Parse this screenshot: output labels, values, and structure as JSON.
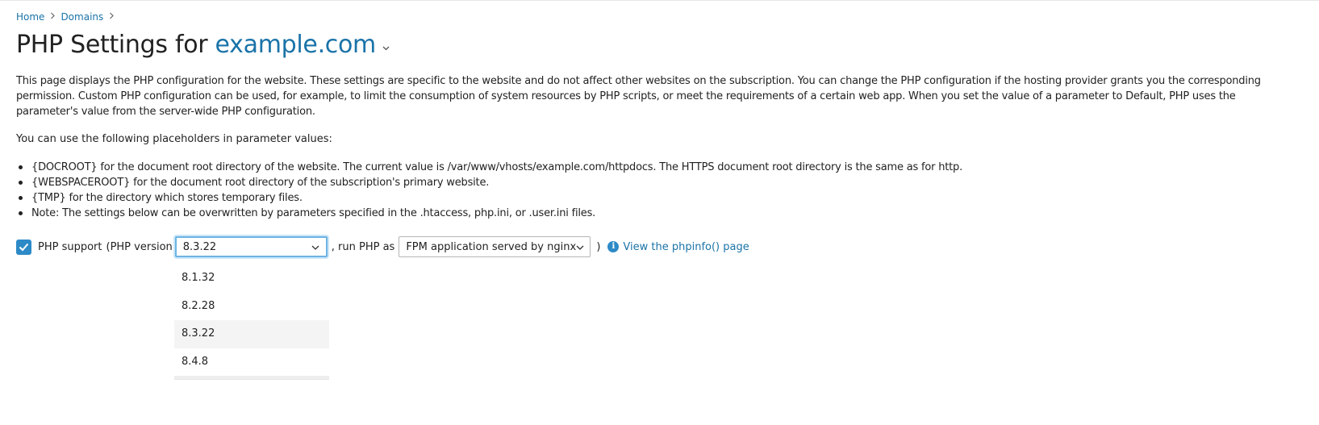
{
  "breadcrumb": {
    "items": [
      "Home",
      "Domains"
    ]
  },
  "header": {
    "title_prefix": "PHP Settings for ",
    "domain": "example.com"
  },
  "intro": {
    "text": "This page displays the PHP configuration for the website. These settings are specific to the website and do not affect other websites on the subscription. You can change the PHP configuration if the hosting provider grants you the corresponding permission. Custom PHP configuration can be used, for example, to limit the consumption of system resources by PHP scripts, or meet the requirements of a certain web app. When you set the value of a parameter to Default, PHP uses the parameter's value from the server-wide PHP configuration.",
    "placeholders_intro": "You can use the following placeholders in parameter values:",
    "bullets": [
      "{DOCROOT} for the document root directory of the website. The current value is /var/www/vhosts/example.com/httpdocs. The HTTPS document root directory is the same as for http.",
      "{WEBSPACEROOT} for the document root directory of the subscription's primary website.",
      "{TMP} for the directory which stores temporary files.",
      "Note: The settings below can be overwritten by parameters specified in the .htaccess, php.ini, or .user.ini files."
    ]
  },
  "php_support": {
    "checked": true,
    "label": "PHP support",
    "version_label": "(PHP version",
    "version_selected": "8.3.22",
    "run_as_label": ", run PHP as",
    "handler_selected": "FPM application served by nginx",
    "close_paren": ")",
    "phpinfo_link": "View the phpinfo() page"
  },
  "version_dropdown": {
    "options": [
      "8.1.32",
      "8.2.28",
      "8.3.22",
      "8.4.8"
    ],
    "highlighted_index": 2
  },
  "colors": {
    "link": "#1a73a8",
    "accent": "#2d8ac7",
    "focus_border": "#6cb4e4",
    "text": "#222222"
  },
  "icons": {
    "breadcrumb_separator": "chevron-right-icon",
    "title_dropdown": "chevron-down-icon",
    "checkbox": "checkmark-icon",
    "info": "info-icon"
  }
}
